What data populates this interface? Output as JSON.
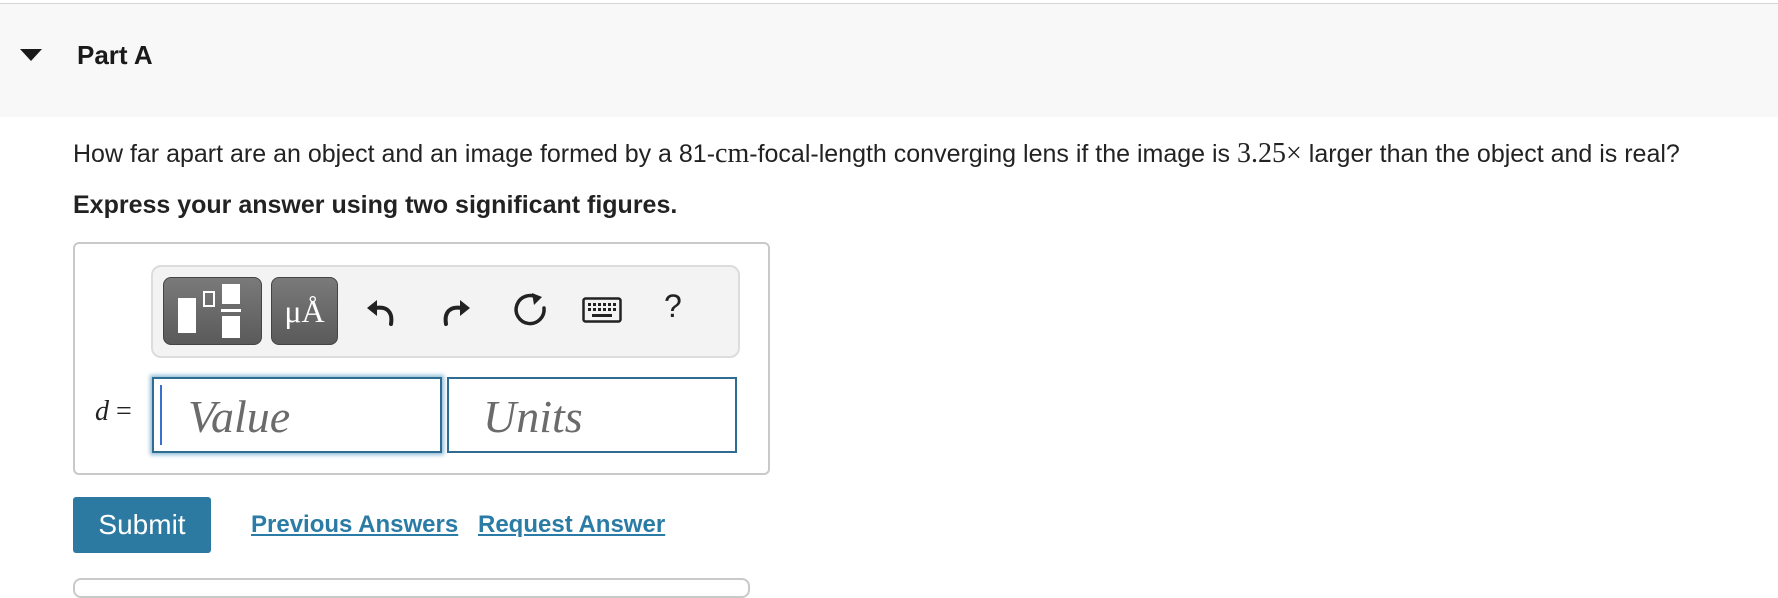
{
  "part": {
    "title": "Part A"
  },
  "question": {
    "text_before": "How far apart are an object and an image formed by a 81-",
    "unit": "cm",
    "text_middle": "-focal-length converging lens if the image is ",
    "magnification": "3.25×",
    "text_after": " larger than the object and is real?",
    "instruction": "Express your answer using two significant figures."
  },
  "toolbar": {
    "units_label": "μÅ",
    "help_label": "?",
    "icons": [
      "templates-icon",
      "units-icon",
      "undo-icon",
      "redo-icon",
      "reset-icon",
      "keyboard-icon",
      "help-icon"
    ]
  },
  "answer": {
    "variable": "d",
    "equals": " =",
    "value_placeholder": "Value",
    "units_placeholder": "Units"
  },
  "actions": {
    "submit_label": "Submit",
    "previous_answers_label": "Previous Answers",
    "request_answer_label": "Request Answer"
  },
  "colors": {
    "accent": "#2c7aa1",
    "link": "#2a7ba6",
    "input_border": "#2f6c91"
  }
}
